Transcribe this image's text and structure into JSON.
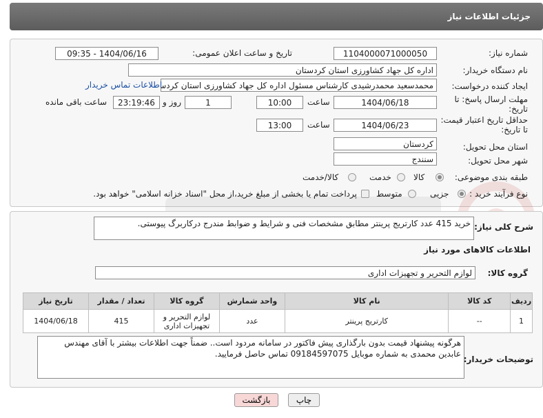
{
  "header": {
    "title": "جزئیات اطلاعات نیاز"
  },
  "fields": {
    "need_number": {
      "label": "شماره نیاز:",
      "value": "1104000071000050"
    },
    "announce": {
      "label": "تاریخ و ساعت اعلان عمومی:",
      "value": "1404/06/16 - 09:35"
    },
    "buyer_org": {
      "label": "نام دستگاه خریدار:",
      "value": "اداره کل جهاد کشاورزی استان کردستان"
    },
    "requester": {
      "label": "ایجاد کننده درخواست:",
      "value": "محمدسعید محمدرشیدی کارشناس مسئول اداره کل جهاد کشاورزی استان کردستان",
      "contact_link": "اطلاعات تماس خریدار"
    },
    "deadline": {
      "label_line1": "مهلت ارسال پاسخ: تا",
      "label_line2": "تاریخ:",
      "date": "1404/06/18",
      "time_label": "ساعت",
      "time": "10:00",
      "days": "1",
      "days_label": "روز و",
      "remaining": "23:19:46",
      "remaining_label": "ساعت باقی مانده"
    },
    "price_validity": {
      "label_line1": "حداقل تاریخ اعتبار قیمت:",
      "label_line2": "تا تاریخ:",
      "date": "1404/06/23",
      "time_label": "ساعت",
      "time": "13:00"
    },
    "province": {
      "label": "استان محل تحویل:",
      "value": "کردستان"
    },
    "city": {
      "label": "شهر محل تحویل:",
      "value": "سنندج"
    },
    "category": {
      "label": "طبقه بندی موضوعی:",
      "options": [
        "کالا",
        "خدمت",
        "کالا/خدمت"
      ],
      "selected": "کالا"
    },
    "purchase_type": {
      "label": "نوع فرآیند خرید :",
      "options": [
        "جزیی",
        "متوسط"
      ],
      "selected": "جزیی",
      "payment_note": "پرداخت تمام یا بخشی از مبلغ خرید،از محل \"اسناد خزانه اسلامی\" خواهد بود."
    }
  },
  "summary": {
    "label": "شرح کلی نیاز:",
    "value": "خرید 415 عدد کارتریج پرینتر مطابق مشخصات فنی و شرایط و ضوابط مندرج درکاربرگ پیوستی."
  },
  "goods_section": {
    "title": "اطلاعات کالاهای مورد نیاز",
    "group_label": "گروه کالا:",
    "group_value": "لوازم التحریر و تجهیزات اداری"
  },
  "table": {
    "headers": [
      "ردیف",
      "کد کالا",
      "نام کالا",
      "واحد شمارش",
      "گروه کالا",
      "تعداد / مقدار",
      "تاریخ نیاز"
    ],
    "rows": [
      [
        "1",
        "--",
        "کارتریج پرینتر",
        "عدد",
        "لوازم التحریر و تجهیزات اداری",
        "415",
        "1404/06/18"
      ]
    ]
  },
  "buyer_notes": {
    "label": "توضیحات خریدار:",
    "value": "هرگونه پیشنهاد قیمت بدون بارگذاری پیش فاکتور در سامانه مردود است.. ضمناً جهت اطلاعات بیشتر با آقای مهندس عابدین محمدی به شماره موبایل  09184597075 تماس حاصل فرمایید."
  },
  "buttons": {
    "print": "چاپ",
    "back": "بازگشت"
  },
  "colors": {
    "header_bg": "#666666",
    "link": "#1a4fa3",
    "back_button": "#f8d7d7"
  }
}
